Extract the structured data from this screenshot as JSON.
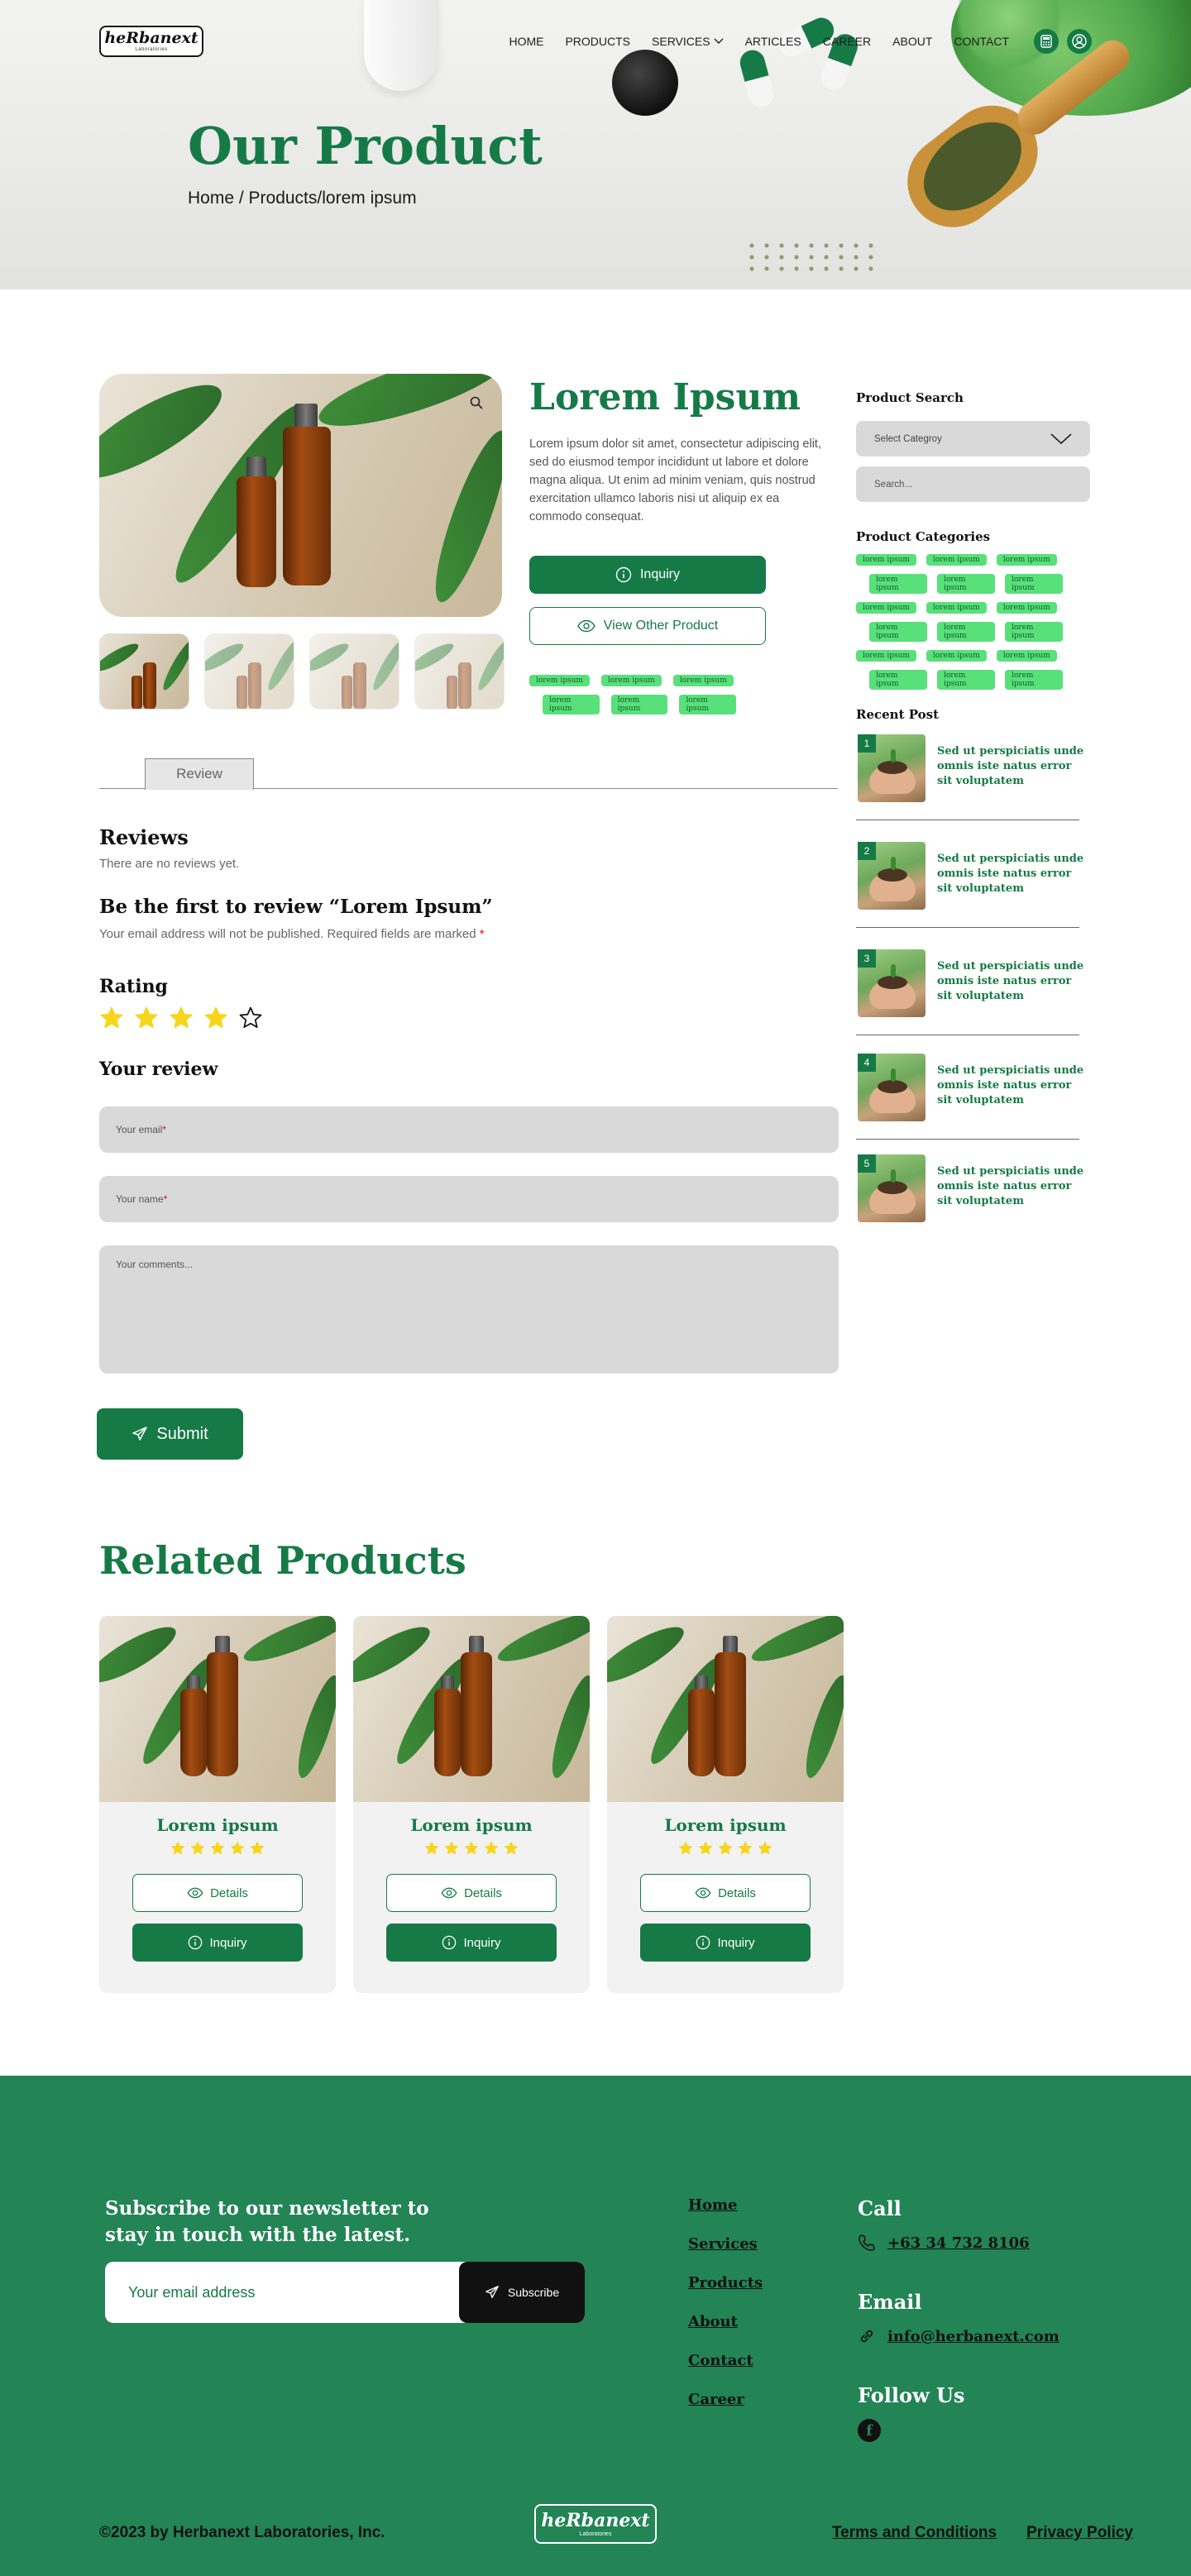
{
  "brand": {
    "logo_text": "heRbanext",
    "logo_sub": "Laboratories"
  },
  "nav": {
    "items": [
      "HOME",
      "PRODUCTS",
      "SERVICES",
      "ARTICLES",
      "CAREER",
      "ABOUT",
      "CONTACT"
    ],
    "icons": [
      "calculator-icon",
      "user-icon"
    ]
  },
  "hero": {
    "title": "Our Product",
    "breadcrumb": "Home / Products/lorem ipsum"
  },
  "product": {
    "title": "Lorem Ipsum",
    "description": "Lorem ipsum dolor sit amet, consectetur adipiscing elit, sed do eiusmod tempor incididunt ut labore et dolore magna aliqua. Ut enim ad minim veniam, quis nostrud exercitation ullamco laboris nisi ut aliquip ex ea commodo consequat.",
    "inquiry_label": "Inquiry",
    "view_other_label": "View Other Product",
    "tags": [
      "lorem ipsum",
      "lorem ipsum",
      "lorem ipsum",
      "lorem ipsum",
      "lorem ipsum",
      "lorem ipsum"
    ]
  },
  "tabs": {
    "review": "Review"
  },
  "reviews": {
    "heading": "Reviews",
    "empty_text": "There are no reviews yet.",
    "first_heading": "Be the first to review “Lorem Ipsum”",
    "notice": "Your email address will not be published. Required fields are marked",
    "required_mark": "*",
    "rating_heading": "Rating",
    "rating_value": 4,
    "rating_max": 5,
    "your_review_heading": "Your review",
    "email_placeholder": "Your email",
    "name_placeholder": "Your name",
    "comment_placeholder": "Your comments...",
    "submit_label": "Submit"
  },
  "sidebar": {
    "search_heading": "Product Search",
    "select_placeholder": "Select Categroy",
    "search_placeholder": "Search...",
    "categories_heading": "Product Categories",
    "category_tag": "lorem ipsum",
    "recent_heading": "Recent Post",
    "posts": [
      {
        "num": "1",
        "title": "Sed ut perspiciatis unde omnis iste natus error sit voluptatem"
      },
      {
        "num": "2",
        "title": "Sed ut perspiciatis unde omnis iste natus error sit voluptatem"
      },
      {
        "num": "3",
        "title": "Sed ut perspiciatis unde omnis iste natus error sit voluptatem"
      },
      {
        "num": "4",
        "title": "Sed ut perspiciatis unde omnis iste natus error sit voluptatem"
      },
      {
        "num": "5",
        "title": "Sed ut perspiciatis unde omnis iste natus error sit voluptatem"
      }
    ]
  },
  "related": {
    "title": "Related Products",
    "cards": [
      {
        "name": "Lorem ipsum",
        "rating": 5,
        "details_label": "Details",
        "inquiry_label": "Inquiry"
      },
      {
        "name": "Lorem ipsum",
        "rating": 5,
        "details_label": "Details",
        "inquiry_label": "Inquiry"
      },
      {
        "name": "Lorem ipsum",
        "rating": 5,
        "details_label": "Details",
        "inquiry_label": "Inquiry"
      }
    ]
  },
  "footer": {
    "newsletter_heading": "Subscribe to our newsletter to stay in touch with the latest.",
    "email_placeholder": "Your email address",
    "subscribe_label": "Subscribe",
    "links": [
      "Home",
      "Services",
      "Products",
      "About",
      "Contact",
      "Career"
    ],
    "call_heading": "Call",
    "phone": "+63 34 732 8106",
    "email_heading": "Email",
    "email": "info@herbanext.com",
    "follow_heading": "Follow Us",
    "copyright": "©2023 by Herbanext Laboratories, Inc.",
    "terms": "Terms and Conditions",
    "privacy": "Privacy Policy"
  },
  "colors": {
    "brand_green": "#167a47",
    "footer_green": "#238456",
    "tag_green": "#58e07a",
    "star_yellow": "#f7d51d"
  }
}
